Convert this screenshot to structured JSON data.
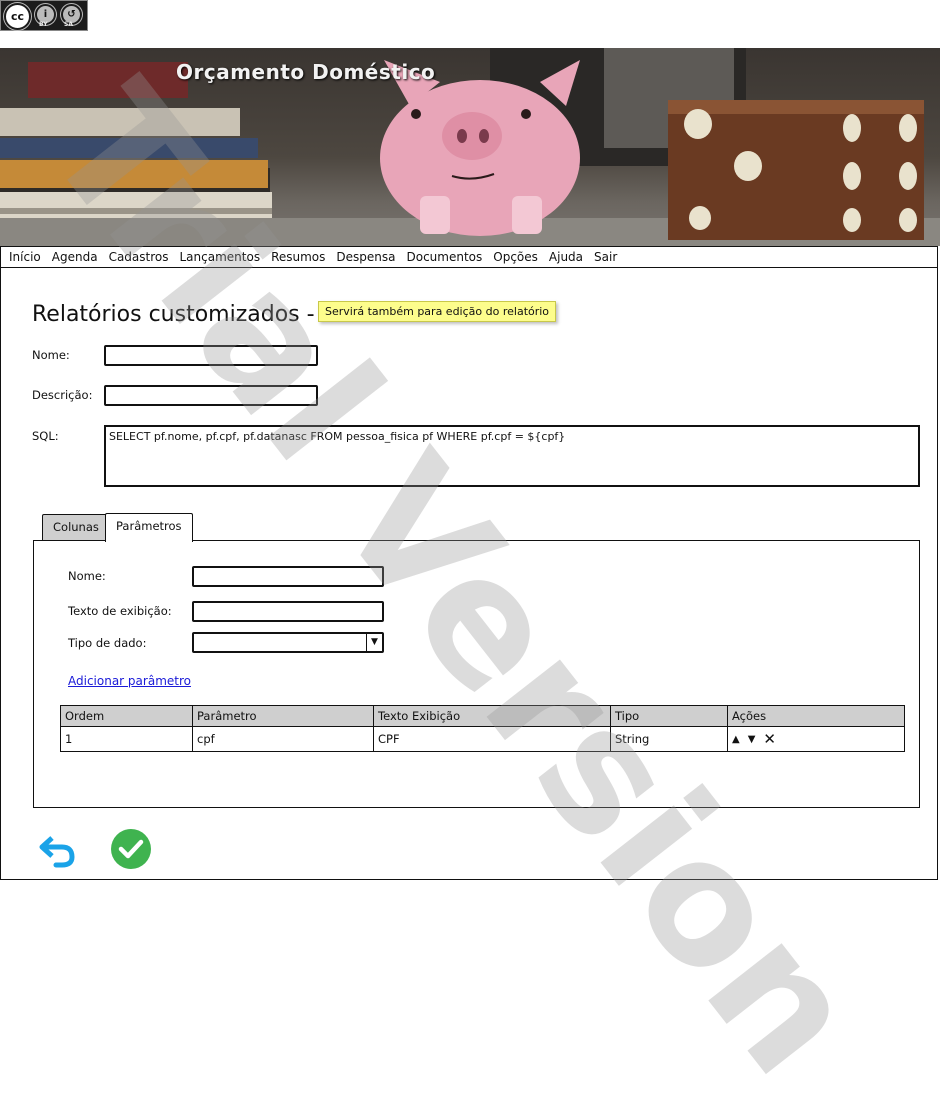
{
  "license": {
    "badge_left": "cc",
    "by": "BY",
    "sa": "SA"
  },
  "app": {
    "title": "Orçamento Doméstico"
  },
  "menu": [
    "Início",
    "Agenda",
    "Cadastros",
    "Lançamentos",
    "Resumos",
    "Despensa",
    "Documentos",
    "Opções",
    "Ajuda",
    "Sair"
  ],
  "page": {
    "title": "Relatórios customizados -",
    "tooltip": "Servirá também para edição do relatório"
  },
  "form": {
    "nome_label": "Nome:",
    "descricao_label": "Descrição:",
    "sql_label": "SQL:",
    "sql_value": "SELECT pf.nome, pf.cpf, pf.datanasc FROM pessoa_fisica pf WHERE pf.cpf = ${cpf}"
  },
  "tabs": [
    {
      "label": "Colunas",
      "active": false
    },
    {
      "label": "Parâmetros",
      "active": true
    }
  ],
  "params_form": {
    "nome_label": "Nome:",
    "texto_label": "Texto de exibição:",
    "tipo_label": "Tipo de dado:",
    "add_link": "Adicionar parâmetro"
  },
  "params_table": {
    "headers": [
      "Ordem",
      "Parâmetro",
      "Texto Exibição",
      "Tipo",
      "Ações"
    ],
    "rows": [
      {
        "ordem": "1",
        "parametro": "cpf",
        "texto": "CPF",
        "tipo": "String"
      }
    ]
  },
  "watermark": "Trial Version",
  "colors": {
    "tooltip_bg": "#fdfd8c",
    "link": "#1a1ad8",
    "back_icon": "#1aa3e8",
    "ok_icon": "#3fb34f",
    "pig": "#e8a5b8"
  }
}
